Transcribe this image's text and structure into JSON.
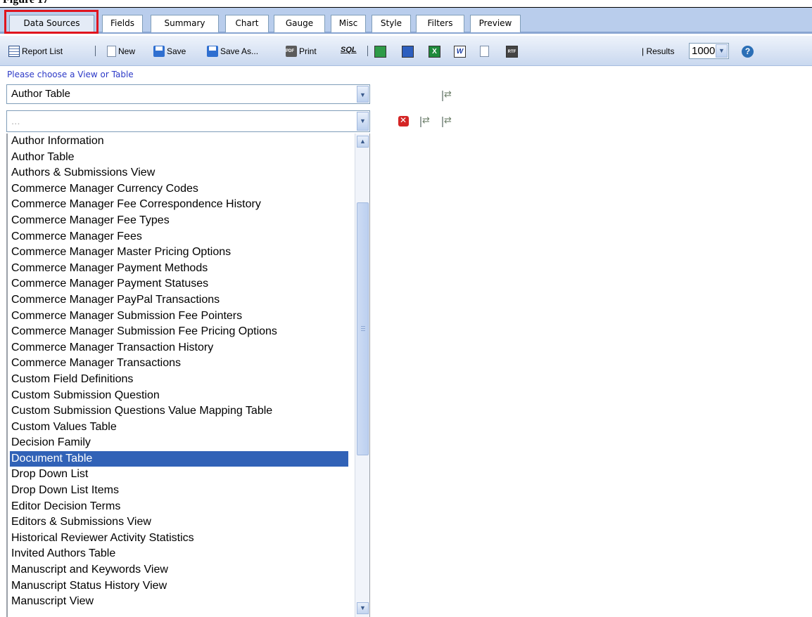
{
  "figure_title": "Figure 17",
  "tabs": [
    "Data Sources",
    "Fields",
    "Summary",
    "Chart",
    "Gauge",
    "Misc",
    "Style",
    "Filters",
    "Preview"
  ],
  "toolbar": {
    "report_list": "Report List",
    "new": "New",
    "save": "Save",
    "save_as": "Save As...",
    "print": "Print",
    "sql": "SQL",
    "results_label": "| Results",
    "results_value": "1000",
    "help": "?"
  },
  "prompt": "Please choose a View or Table",
  "primary_select": {
    "value": "Author Table"
  },
  "secondary_select": {
    "value": "..."
  },
  "list_items": [
    "Author Information",
    "Author Table",
    "Authors & Submissions View",
    "Commerce Manager Currency Codes",
    "Commerce Manager Fee Correspondence History",
    "Commerce Manager Fee Types",
    "Commerce Manager Fees",
    "Commerce Manager Master Pricing Options",
    "Commerce Manager Payment Methods",
    "Commerce Manager Payment Statuses",
    "Commerce Manager PayPal Transactions",
    "Commerce Manager Submission Fee Pointers",
    "Commerce Manager Submission Fee Pricing Options",
    "Commerce Manager Transaction History",
    "Commerce Manager Transactions",
    "Custom Field Definitions",
    "Custom Submission Question",
    "Custom Submission Questions Value Mapping Table",
    "Custom Values Table",
    "Decision Family",
    "Document Table",
    "Drop Down List",
    "Drop Down List Items",
    "Editor Decision Terms",
    "Editors & Submissions View",
    "Historical Reviewer Activity Statistics",
    "Invited Authors Table",
    "Manuscript and Keywords View",
    "Manuscript Status History View",
    "Manuscript View"
  ],
  "selected_item": "Document Table",
  "colors": {
    "accent": "#3162b7",
    "highlight": "#e0141e",
    "tabbar": "#b9cdec",
    "prompt": "#2c39c7"
  }
}
